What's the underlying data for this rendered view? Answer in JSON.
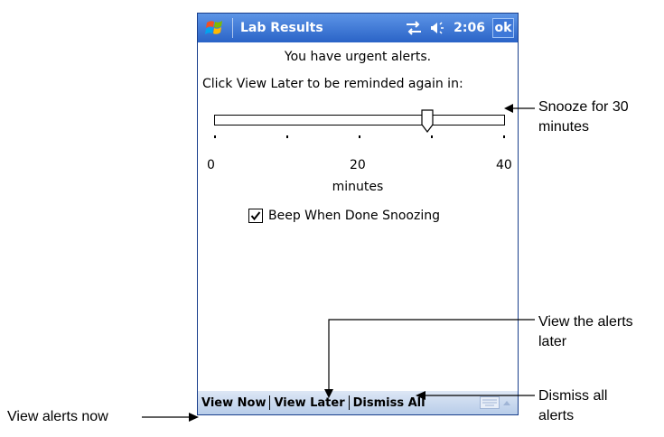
{
  "window": {
    "title": "Lab Results",
    "time": "2:06",
    "ok_label": "ok"
  },
  "alert": {
    "headline": "You have urgent alerts.",
    "instruction": "Click View Later to be reminded again in:"
  },
  "slider": {
    "min_label": "0",
    "mid_label": "20",
    "max_label": "40",
    "units": "minutes",
    "value_minutes": 30
  },
  "checkbox": {
    "label": "Beep When Done Snoozing",
    "checked": true
  },
  "menubar": {
    "view_now": "View Now",
    "view_later": "View Later",
    "dismiss_all": "Dismiss All"
  },
  "callouts": {
    "snooze_line1": "Snooze for 30",
    "snooze_line2": "minutes",
    "view_later_line1": "View the alerts",
    "view_later_line2": "later",
    "dismiss_line1": "Dismiss all",
    "dismiss_line2": "alerts",
    "view_now": "View alerts now"
  },
  "colors": {
    "titlebar": "#2a63c7",
    "menubar": "#c9d9ef"
  }
}
